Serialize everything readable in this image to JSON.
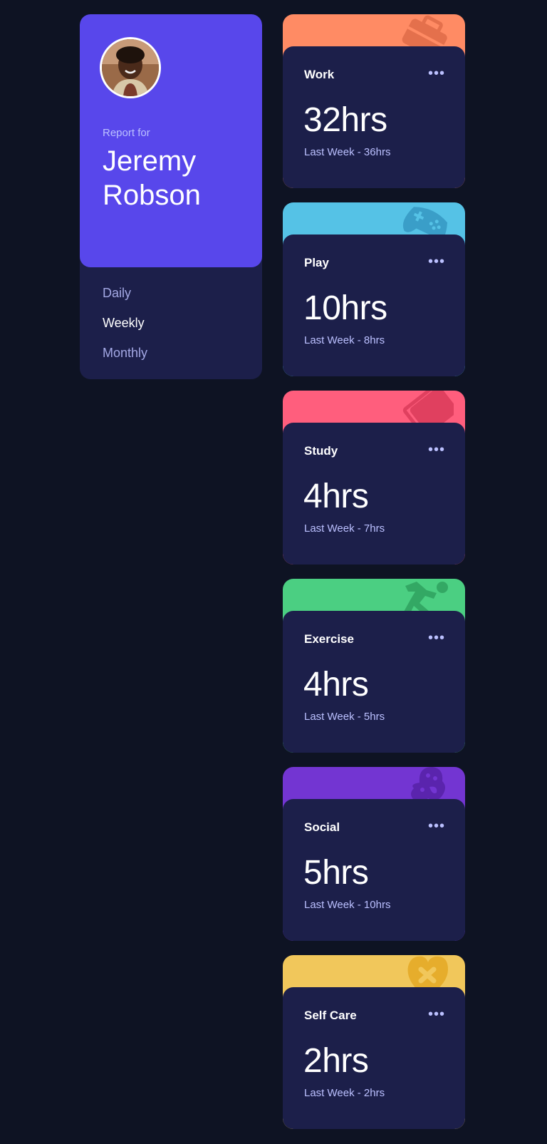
{
  "profile": {
    "report_label": "Report for",
    "first_name": "Jeremy",
    "last_name": "Robson"
  },
  "periods": [
    {
      "label": "Daily",
      "active": false
    },
    {
      "label": "Weekly",
      "active": true
    },
    {
      "label": "Monthly",
      "active": false
    }
  ],
  "cards": [
    {
      "title": "Work",
      "hours": "32hrs",
      "previous": "Last Week - 36hrs",
      "color": "#ff8b64",
      "icon": "briefcase-icon"
    },
    {
      "title": "Play",
      "hours": "10hrs",
      "previous": "Last Week - 8hrs",
      "color": "#55c2e6",
      "icon": "gamepad-icon"
    },
    {
      "title": "Study",
      "hours": "4hrs",
      "previous": "Last Week - 7hrs",
      "color": "#ff5e7d",
      "icon": "book-icon"
    },
    {
      "title": "Exercise",
      "hours": "4hrs",
      "previous": "Last Week - 5hrs",
      "color": "#4bcf82",
      "icon": "runner-icon"
    },
    {
      "title": "Social",
      "hours": "5hrs",
      "previous": "Last Week - 10hrs",
      "color": "#7335d2",
      "icon": "social-icon"
    },
    {
      "title": "Self Care",
      "hours": "2hrs",
      "previous": "Last Week - 2hrs",
      "color": "#f1c75b",
      "icon": "heart-icon"
    }
  ],
  "menu_symbol": "•••"
}
